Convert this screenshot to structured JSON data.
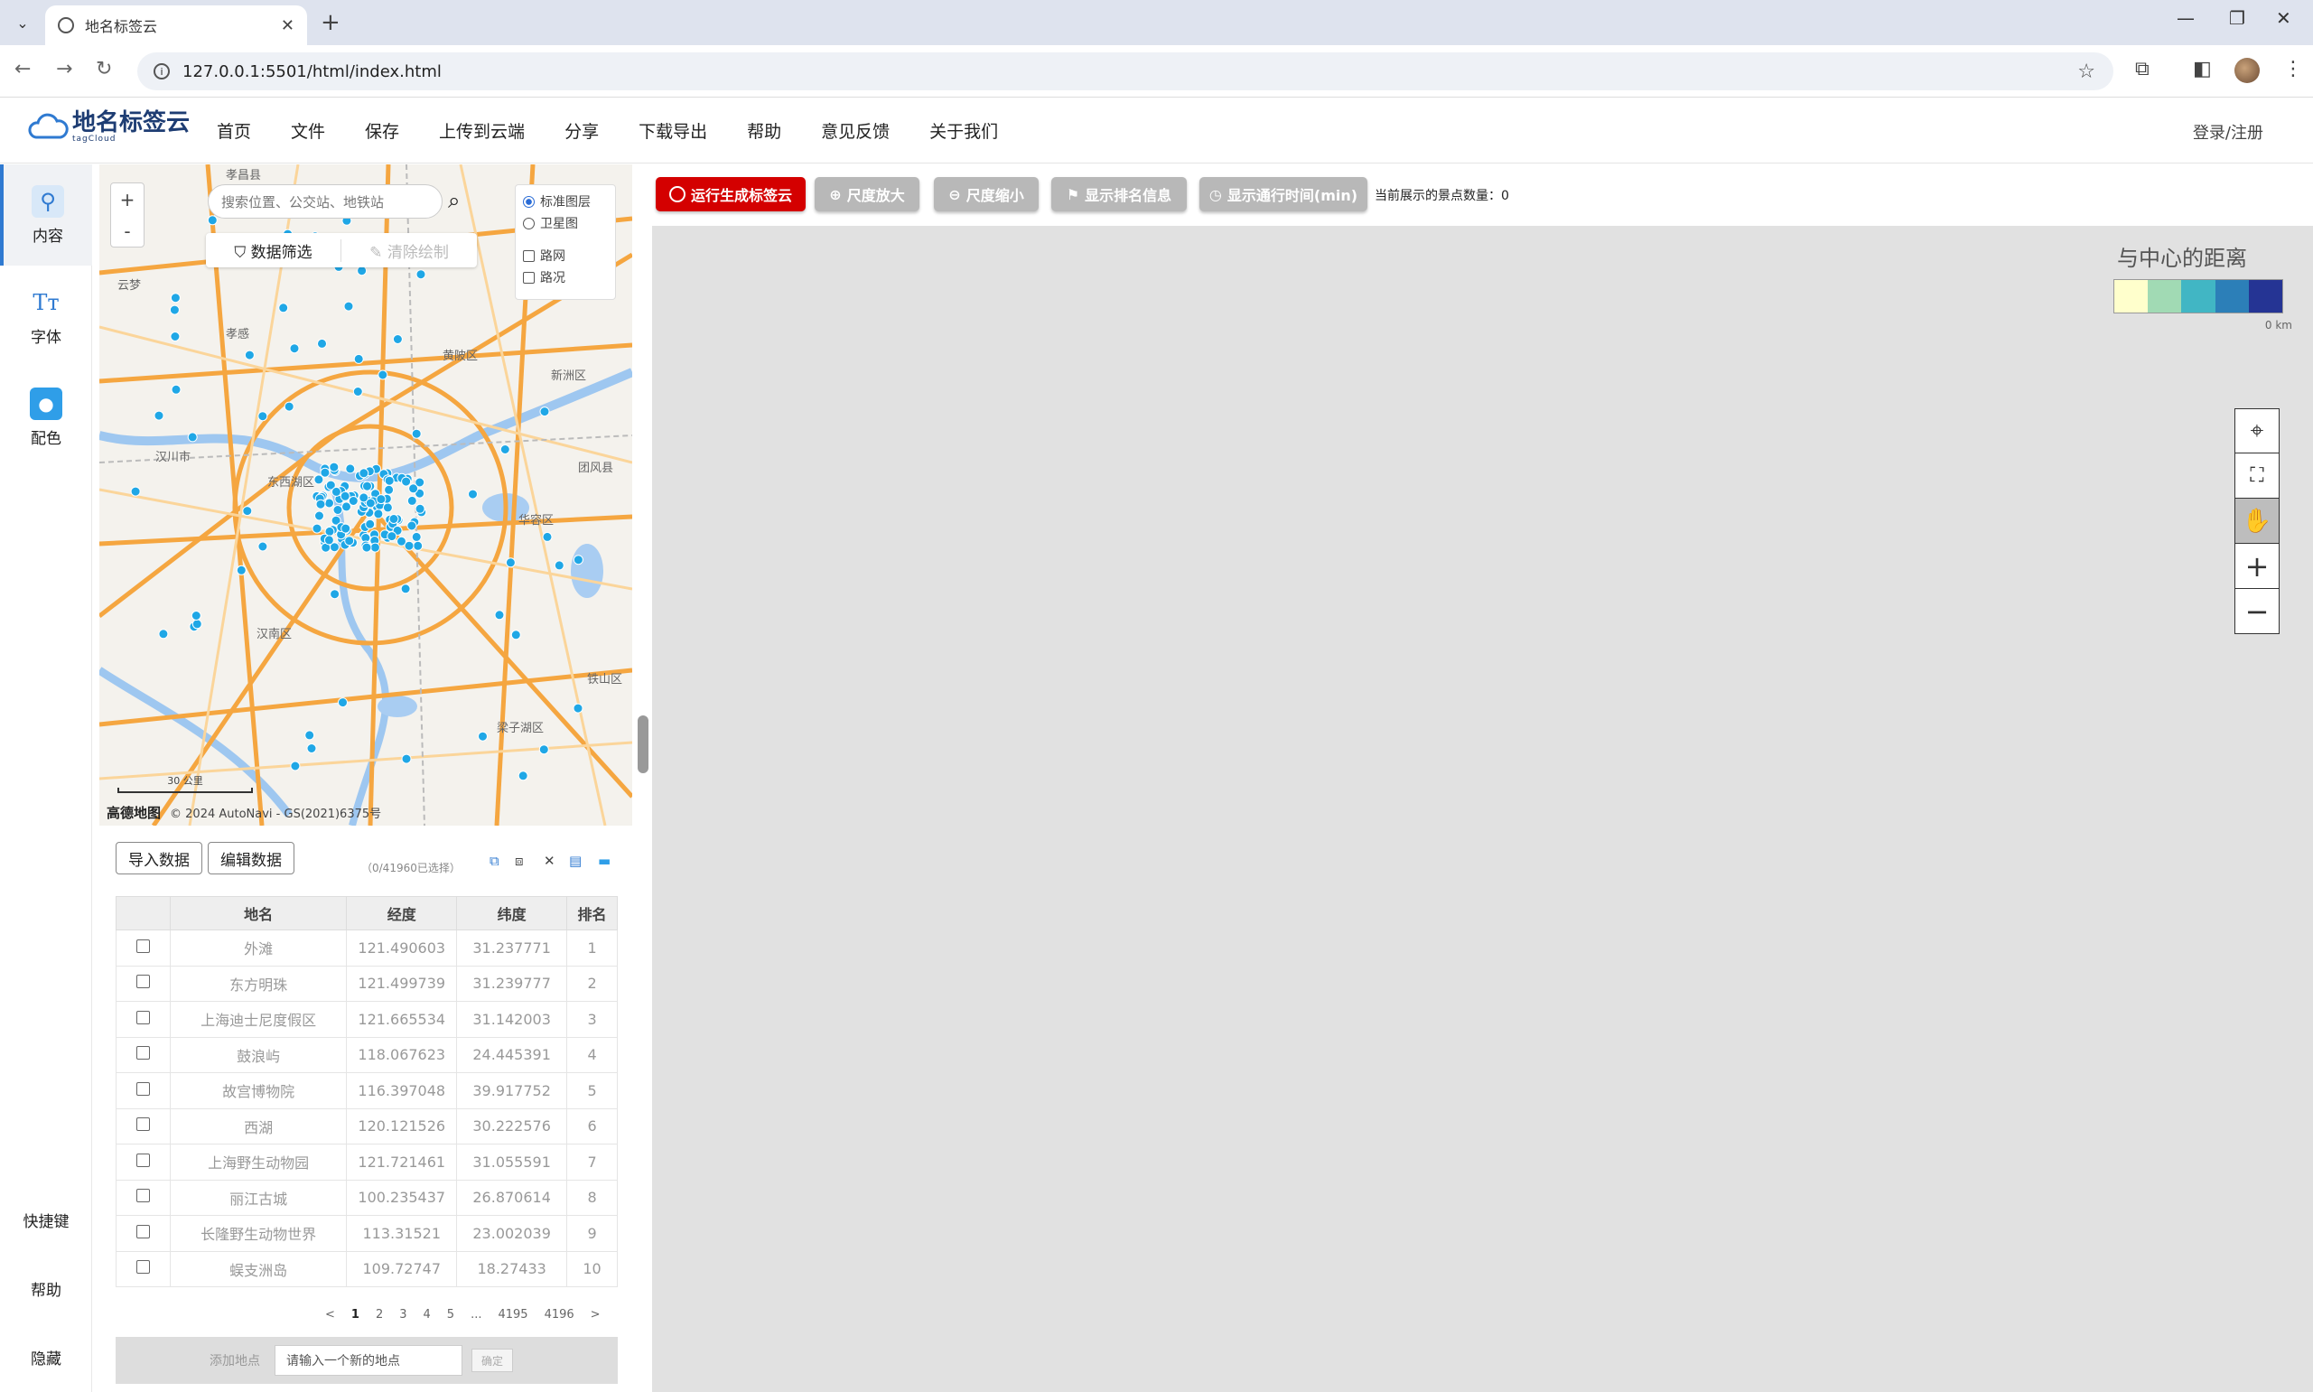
{
  "browser": {
    "tab_title": "地名标签云",
    "url": "127.0.0.1:5501/html/index.html"
  },
  "app": {
    "logo_text": "地名标签云",
    "logo_sub": "tagCloud",
    "menu": [
      "首页",
      "文件",
      "保存",
      "上传到云端",
      "分享",
      "下载导出",
      "帮助",
      "意见反馈",
      "关于我们"
    ],
    "login": "登录/注册"
  },
  "sidebar": {
    "items": [
      {
        "label": "内容",
        "icon": "location-pin-icon"
      },
      {
        "label": "字体",
        "icon": "font-icon"
      },
      {
        "label": "配色",
        "icon": "palette-icon"
      }
    ],
    "bottom": [
      "快捷键",
      "帮助",
      "隐藏"
    ]
  },
  "map": {
    "search_placeholder": "搜索位置、公交站、地铁站",
    "filter_label": "数据筛选",
    "clear_label": "清除绘制",
    "layers": {
      "standard": "标准图层",
      "satellite": "卫星图",
      "roads": "路网",
      "traffic": "路况"
    },
    "zoom_in": "+",
    "zoom_out": "-",
    "scale": "30 公里",
    "brand": "高德地图",
    "attribution": "© 2024 AutoNavi - GS(2021)6375号",
    "place_labels": [
      "孝昌县",
      "汉川市",
      "东西湖区",
      "汉南区",
      "新洲区",
      "团风县",
      "华容区",
      "梁子湖区",
      "铁山区",
      "黄陂区",
      "孝感",
      "云梦"
    ]
  },
  "data_panel": {
    "import_label": "导入数据",
    "edit_label": "编辑数据",
    "selection": "（0/41960已选择）",
    "columns": [
      "地名",
      "经度",
      "纬度",
      "排名"
    ],
    "rows": [
      {
        "name": "外滩",
        "lng": "121.490603",
        "lat": "31.237771",
        "rank": "1"
      },
      {
        "name": "东方明珠",
        "lng": "121.499739",
        "lat": "31.239777",
        "rank": "2"
      },
      {
        "name": "上海迪士尼度假区",
        "lng": "121.665534",
        "lat": "31.142003",
        "rank": "3"
      },
      {
        "name": "鼓浪屿",
        "lng": "118.067623",
        "lat": "24.445391",
        "rank": "4"
      },
      {
        "name": "故宫博物院",
        "lng": "116.397048",
        "lat": "39.917752",
        "rank": "5"
      },
      {
        "name": "西湖",
        "lng": "120.121526",
        "lat": "30.222576",
        "rank": "6"
      },
      {
        "name": "上海野生动物园",
        "lng": "121.721461",
        "lat": "31.055591",
        "rank": "7"
      },
      {
        "name": "丽江古城",
        "lng": "100.235437",
        "lat": "26.870614",
        "rank": "8"
      },
      {
        "name": "长隆野生动物世界",
        "lng": "113.31521",
        "lat": "23.002039",
        "rank": "9"
      },
      {
        "name": "蜈支洲岛",
        "lng": "109.72747",
        "lat": "18.27433",
        "rank": "10"
      }
    ],
    "pager": [
      "<",
      "1",
      "2",
      "3",
      "4",
      "5",
      "...",
      "4195",
      "4196",
      ">"
    ],
    "add_label": "添加地点",
    "add_placeholder": "请输入一个新的地点",
    "confirm_label": "确定"
  },
  "toolbar": {
    "run_label": "运行生成标签云",
    "zoom_in_label": "尺度放大",
    "zoom_out_label": "尺度缩小",
    "rank_label": "显示排名信息",
    "time_label": "显示通行时间(min)",
    "count_label": "当前展示的景点数量：",
    "count_value": "0"
  },
  "legend": {
    "title": "与中心的距离",
    "colors": [
      "#ffffcc",
      "#a1dab4",
      "#41b6c4",
      "#2c7fb8",
      "#253494"
    ],
    "min_label": "0 km"
  },
  "colors": {
    "accent": "#2f7ad1",
    "run_button": "#d40000",
    "point": "#1fa7e6",
    "road": "#f5a640"
  }
}
